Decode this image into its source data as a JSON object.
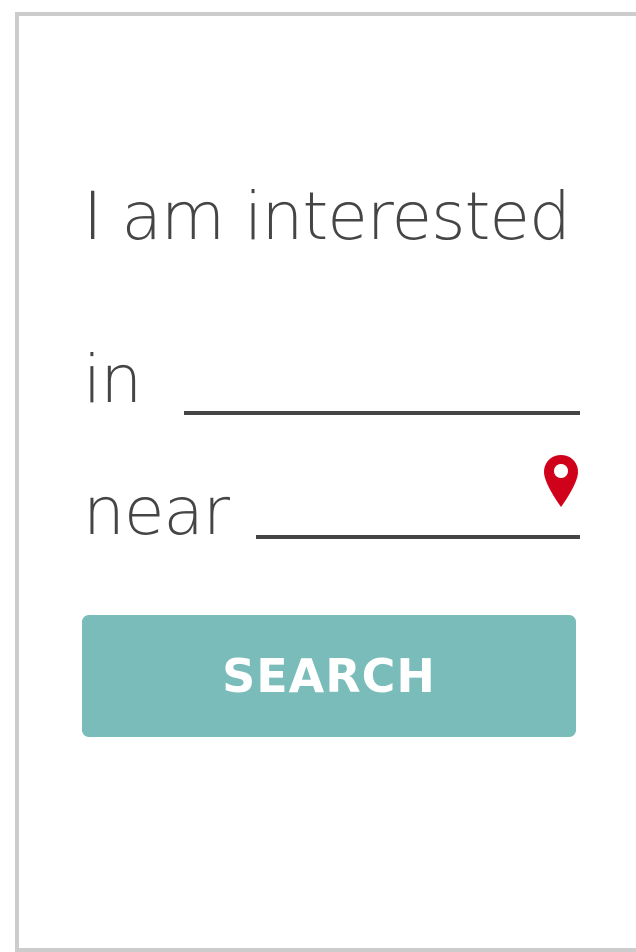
{
  "form": {
    "heading": "I am interested",
    "in_label": "in",
    "in_value": "",
    "near_label": "near",
    "near_value": "",
    "location_icon": "map-pin-icon",
    "search_label": "SEARCH"
  },
  "colors": {
    "text": "#454545",
    "button": "#7abcba",
    "button_text": "#ffffff",
    "pin": "#d0021b",
    "border": "#cccccc"
  }
}
